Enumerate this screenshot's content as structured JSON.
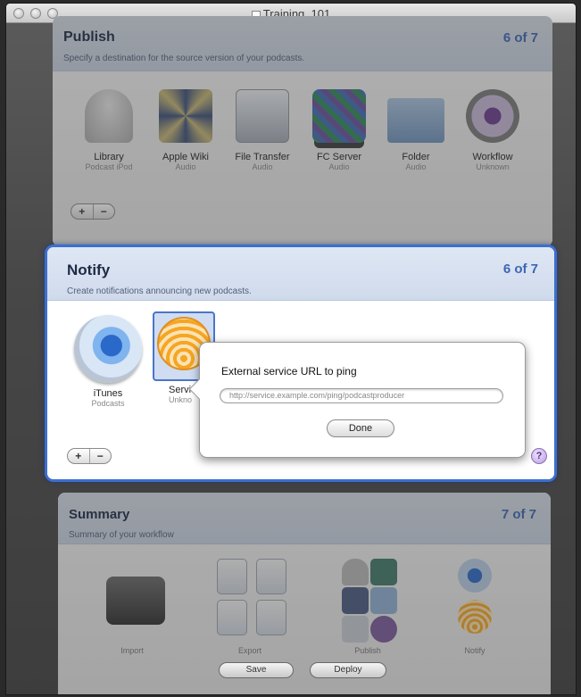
{
  "window": {
    "title": "Training_101"
  },
  "publish": {
    "title": "Publish",
    "subtitle": "Specify a destination for the source version of your podcasts.",
    "step": "6 of 7",
    "items": [
      {
        "label": "Library",
        "sub": "Podcast iPod",
        "icon": "library-icon"
      },
      {
        "label": "Apple Wiki",
        "sub": "Audio",
        "icon": "wiki-icon"
      },
      {
        "label": "File Transfer",
        "sub": "Audio",
        "icon": "file-transfer-icon"
      },
      {
        "label": "FC Server",
        "sub": "Audio",
        "icon": "fc-server-icon"
      },
      {
        "label": "Folder",
        "sub": "Audio",
        "icon": "folder-icon"
      },
      {
        "label": "Workflow",
        "sub": "Unknown",
        "icon": "workflow-icon"
      }
    ],
    "plus": "+",
    "minus": "−"
  },
  "notify": {
    "title": "Notify",
    "subtitle": "Create notifications announcing new podcasts.",
    "step": "6 of 7",
    "items": [
      {
        "label": "iTunes",
        "sub": "Podcasts",
        "icon": "itunes-icon"
      },
      {
        "label": "Servi",
        "sub": "Unkno",
        "icon": "service-ping-icon"
      }
    ],
    "plus": "+",
    "minus": "−",
    "help": "?"
  },
  "popover": {
    "label": "External service URL to ping",
    "placeholder": "http://service.example.com/ping/podcastproducer",
    "done": "Done"
  },
  "summary": {
    "title": "Summary",
    "subtitle": "Summary of your workflow",
    "step": "7 of 7",
    "groups": [
      {
        "label": "Import"
      },
      {
        "label": "Export"
      },
      {
        "label": "Publish"
      },
      {
        "label": "Notify"
      }
    ]
  },
  "footer": {
    "save": "Save",
    "deploy": "Deploy"
  },
  "colors": {
    "accent": "#3c6fd0",
    "step_text": "#3b67b4"
  }
}
